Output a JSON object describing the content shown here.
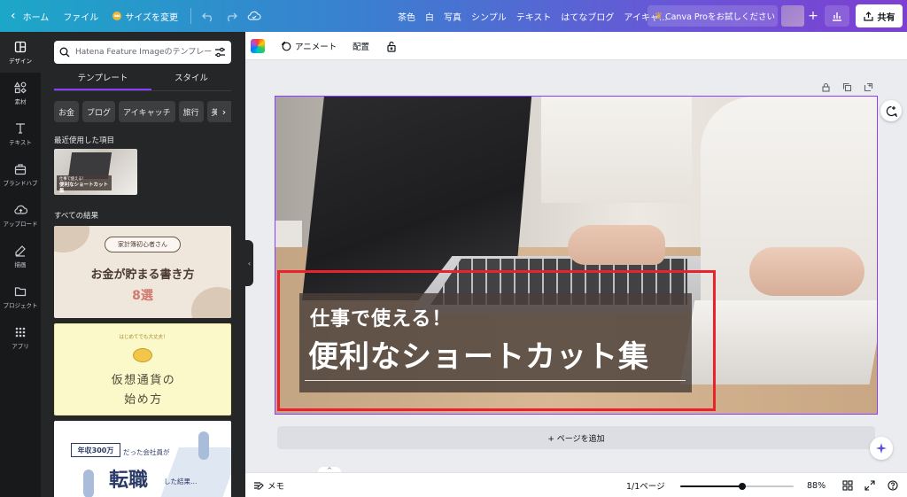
{
  "topbar": {
    "back_label": "ホーム",
    "file_label": "ファイル",
    "resize_label": "サイズを変更",
    "design_title_items": [
      "茶色",
      "白",
      "写真",
      "シンプル",
      "テキスト",
      "はてなブログ",
      "アイキャ..."
    ],
    "pro_label": "Canva Proをお試しください",
    "plus_label": "+",
    "share_label": "共有"
  },
  "rail": {
    "items": [
      {
        "label": "デザイン",
        "icon": "layout-icon"
      },
      {
        "label": "素材",
        "icon": "shapes-icon"
      },
      {
        "label": "テキスト",
        "icon": "text-icon"
      },
      {
        "label": "ブランドハブ",
        "icon": "brand-icon"
      },
      {
        "label": "アップロード",
        "icon": "cloud-upload-icon"
      },
      {
        "label": "描画",
        "icon": "pen-icon"
      },
      {
        "label": "プロジェクト",
        "icon": "folder-icon"
      },
      {
        "label": "アプリ",
        "icon": "apps-icon"
      }
    ]
  },
  "panel": {
    "search_placeholder": "Hatena Feature Imageのテンプレー",
    "tabs": [
      "テンプレート",
      "スタイル"
    ],
    "chips": [
      "お金",
      "ブログ",
      "アイキャッチ",
      "旅行",
      "美容"
    ],
    "recent_label": "最近使用した項目",
    "recent_thumb": {
      "small": "仕事で使える！",
      "big": "便利なショートカット集"
    },
    "all_results_label": "すべての結果",
    "card1": {
      "pill": "家計簿初心者さん",
      "line1": "お金が貯まる書き方",
      "line2": "8選"
    },
    "card2": {
      "arc": "はじめてでも大丈夫！",
      "line1": "仮想通貨の",
      "line2": "始め方"
    },
    "card3": {
      "box": "年収300万",
      "line0": "だった会社員が",
      "line1": "転職",
      "line2": "した結果…"
    }
  },
  "toolbar": {
    "animate_label": "アニメート",
    "position_label": "配置"
  },
  "canvas": {
    "subtitle": "仕事で使える！",
    "title": "便利なショートカット集",
    "add_page_label": "+ ページを追加"
  },
  "bottombar": {
    "notes_label": "メモ",
    "pages_label": "1/1ページ",
    "zoom_percent": 88,
    "zoom_label": "88%",
    "zoom_slider_fraction": 0.55
  },
  "colors": {
    "accent_purple": "#8b3dff",
    "highlight_red": "#e8232d",
    "rail_bg": "#18191b",
    "panel_bg": "#252627"
  }
}
